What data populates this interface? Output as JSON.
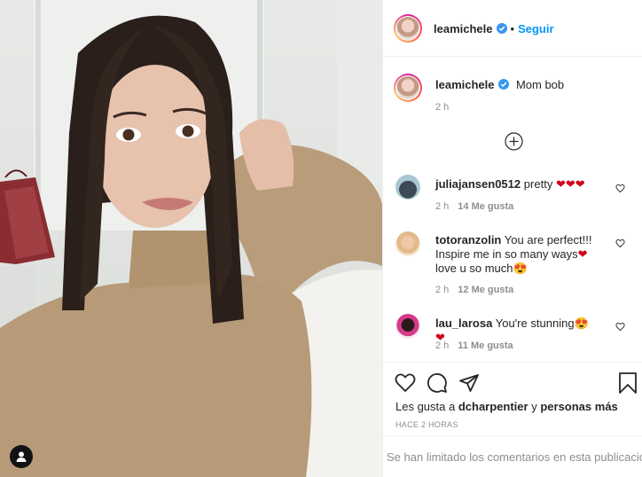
{
  "post": {
    "author": "leamichele",
    "follow_label": "Seguir",
    "caption": "Mom bob",
    "caption_time": "2 h"
  },
  "comments": [
    {
      "username": "juliajansen0512",
      "text": "pretty ❤❤❤",
      "time": "2 h",
      "likes": "14 Me gusta"
    },
    {
      "username": "totoranzolin",
      "text": "You are perfect!!! Inspire me in so many ways❤ love u so much😍",
      "time": "2 h",
      "likes": "12 Me gusta"
    },
    {
      "username": "lau_larosa",
      "text": "You're stunning😍❤",
      "time": "2 h",
      "likes": "11 Me gusta"
    }
  ],
  "likes": {
    "prefix": "Les gusta a",
    "user": "dcharpentier",
    "joiner": "y",
    "others": "personas más"
  },
  "post_time": "HACE 2 HORAS",
  "footer_text": "Se han limitado los comentarios en esta publicación",
  "icons": {
    "like": "heart-icon",
    "comment": "comment-icon",
    "share": "paper-plane-icon",
    "save": "bookmark-icon",
    "load_more": "plus-circle-icon",
    "tags": "user-tag-icon"
  },
  "colors": {
    "accent": "#0095f6",
    "muted": "#8e8e8e",
    "text": "#262626"
  }
}
